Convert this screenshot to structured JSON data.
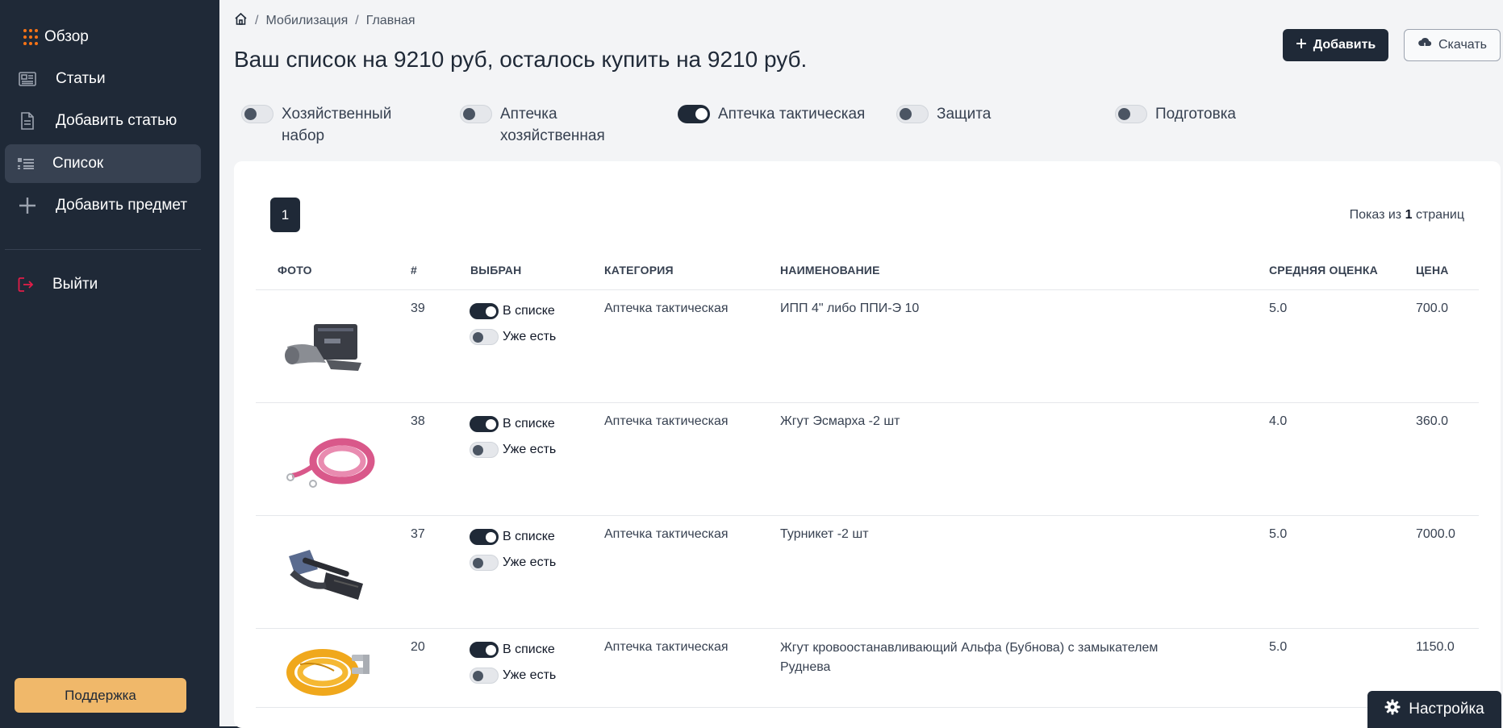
{
  "sidebar": {
    "items": [
      {
        "label": "Обзор",
        "icon": "dots-grid-icon"
      },
      {
        "label": "Статьи",
        "icon": "newspaper-icon"
      },
      {
        "label": "Добавить статью",
        "icon": "document-icon"
      },
      {
        "label": "Список",
        "icon": "list-icon"
      },
      {
        "label": "Добавить предмет",
        "icon": "plus-icon"
      }
    ],
    "logout_label": "Выйти",
    "support_label": "Поддержка"
  },
  "breadcrumb": {
    "home_icon": "home-icon",
    "items": [
      "Мобилизация",
      "Главная"
    ],
    "separator": "/"
  },
  "header": {
    "title": "Ваш список на 9210 руб, осталось купить на 9210 руб.",
    "add_label": "Добавить",
    "download_label": "Скачать"
  },
  "filters": [
    {
      "line1": "Хозяйственный",
      "line2": "набор",
      "on": false
    },
    {
      "line1": "Аптечка",
      "line2": "хозяйственная",
      "on": false
    },
    {
      "line1": "Аптечка тактическая",
      "line2": "",
      "on": true
    },
    {
      "line1": "Защита",
      "line2": "",
      "on": false
    },
    {
      "line1": "Подготовка",
      "line2": "",
      "on": false
    }
  ],
  "pagination": {
    "current": "1",
    "info_prefix": "Показ из",
    "info_count": "1",
    "info_suffix": "страниц"
  },
  "table": {
    "columns": [
      "ФОТО",
      "#",
      "ВЫБРАН",
      "КАТЕГОРИЯ",
      "НАИМЕНОВАНИЕ",
      "СРЕДНЯЯ ОЦЕНКА",
      "ЦЕНА"
    ],
    "in_list_label": "В списке",
    "have_label": "Уже есть",
    "rows": [
      {
        "id": "39",
        "category": "Аптечка тактическая",
        "name": "ИПП 4\" либо ППИ-Э 10",
        "rating": "5.0",
        "price": "700.0",
        "in_list": true,
        "have": false
      },
      {
        "id": "38",
        "category": "Аптечка тактическая",
        "name": "Жгут Эсмарха -2 шт",
        "rating": "4.0",
        "price": "360.0",
        "in_list": true,
        "have": false
      },
      {
        "id": "37",
        "category": "Аптечка тактическая",
        "name": "Турникет -2 шт",
        "rating": "5.0",
        "price": "7000.0",
        "in_list": true,
        "have": false
      },
      {
        "id": "20",
        "category": "Аптечка тактическая",
        "name": "Жгут кровоостанавливающий Альфа (Бубнова) с замыкателем",
        "name2": "Руднева",
        "rating": "5.0",
        "price": "1150.0",
        "in_list": true,
        "have": false
      }
    ]
  },
  "settings_label": "Настройка",
  "colors": {
    "sidebar_bg": "#1f2937",
    "accent_orange": "#f97316",
    "logout_red": "#e11d48",
    "support_bg": "#f0b86a"
  }
}
